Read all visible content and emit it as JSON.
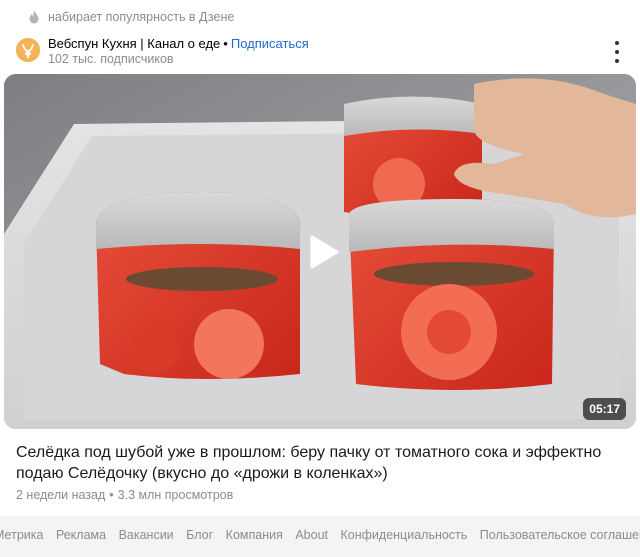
{
  "trend": {
    "text": "набирает популярность в Дзене",
    "icon": "flame-icon"
  },
  "channel": {
    "name": "Вебспун Кухня | Канал о еде",
    "separator": "•",
    "subscribe_label": "Подписаться",
    "subscribers": "102 тыс. подписчиков",
    "avatar_color": "#f1b356",
    "subscribe_color": "#1e69d2"
  },
  "video": {
    "duration": "05:17",
    "title": "Селёдка под шубой уже в прошлом: беру пачку от томатного сока и эффектно подаю Селёдочку (вкусно до «дрожи в коленках»)",
    "age": "2 недели назад",
    "separator": "•",
    "views": "3.3 млн просмотров"
  },
  "footer": {
    "links": [
      "Метрика",
      "Реклама",
      "Вакансии",
      "Блог",
      "Компания",
      "About",
      "Конфиденциальность",
      "Пользовательское соглашение"
    ]
  }
}
